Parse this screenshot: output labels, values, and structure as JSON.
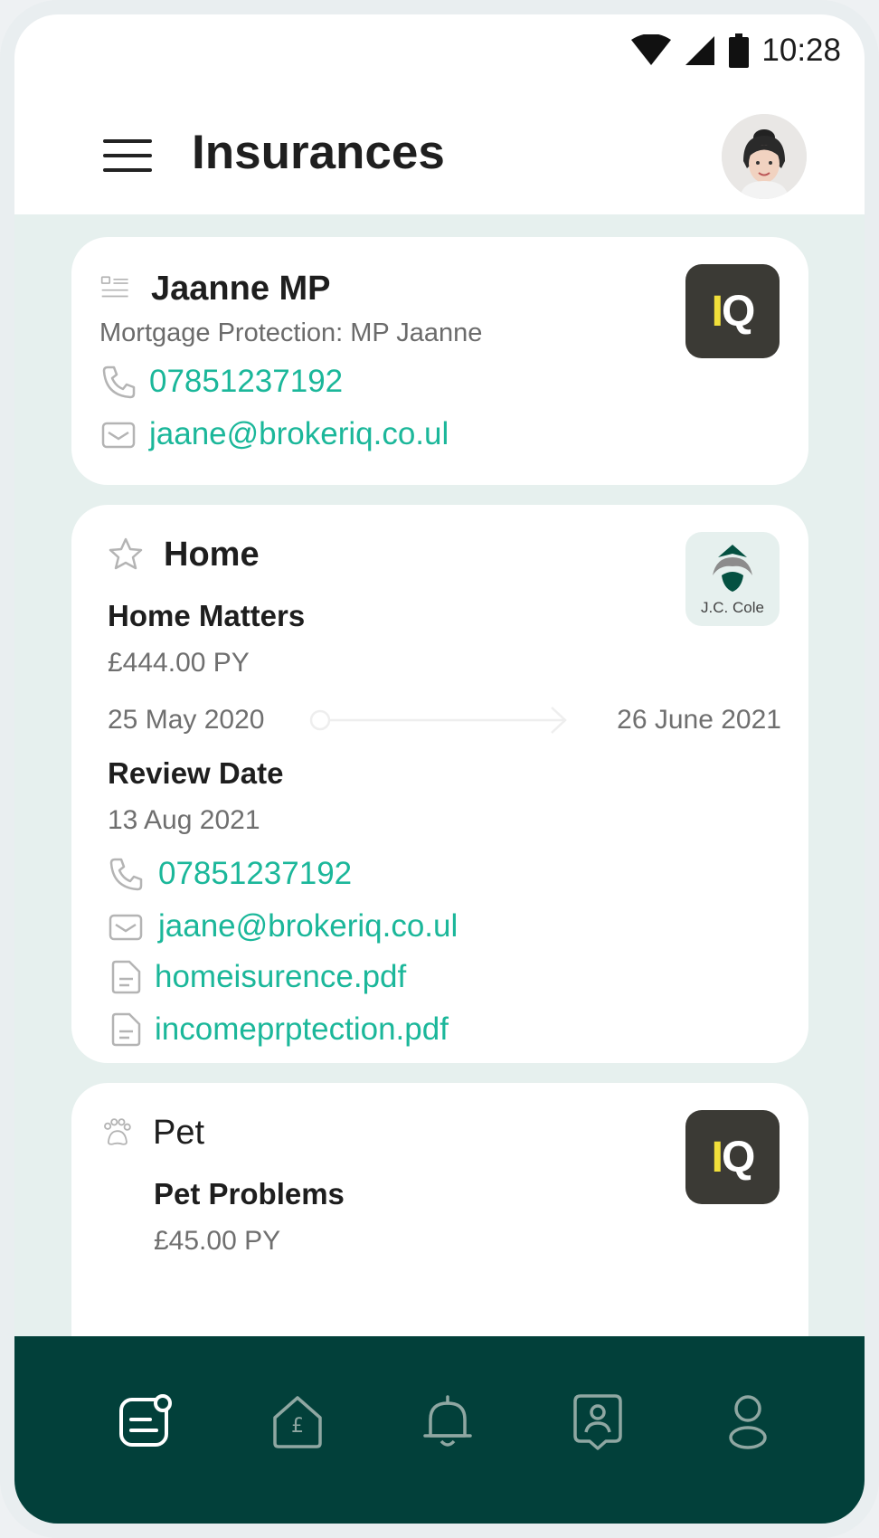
{
  "status_bar": {
    "time": "10:28"
  },
  "header": {
    "title": "Insurances"
  },
  "cards": [
    {
      "title": "Jaanne MP",
      "subtitle": "Mortgage Protection: MP Jaanne",
      "phone": "07851237192",
      "email": "jaane@brokeriq.co.ul",
      "logo": "IQ"
    },
    {
      "title": "Home",
      "product": "Home Matters",
      "price": "£444.00 PY",
      "start_date": "25 May 2020",
      "end_date": "26 June 2021",
      "review_label": "Review Date",
      "review_date": "13 Aug 2021",
      "phone": "07851237192",
      "email": "jaane@brokeriq.co.ul",
      "files": [
        "homeisurence.pdf",
        "incomeprptection.pdf"
      ],
      "logo": "J.C. Cole"
    },
    {
      "title": "Pet",
      "product": "Pet Problems",
      "price": "£45.00 PY",
      "logo": "IQ"
    }
  ],
  "icons": {
    "menu": "hamburger-icon",
    "card_type": [
      "id-card-icon",
      "star-icon",
      "paw-icon"
    ],
    "phone": "phone-icon",
    "email": "mail-icon",
    "file": "file-icon"
  },
  "bottom_nav": [
    "policies-icon",
    "home-finance-icon",
    "bell-icon",
    "contact-icon",
    "user-icon"
  ],
  "colors": {
    "accent": "#1bb79a",
    "nav_bg": "#02403a",
    "content_bg": "#e6f0ee"
  }
}
